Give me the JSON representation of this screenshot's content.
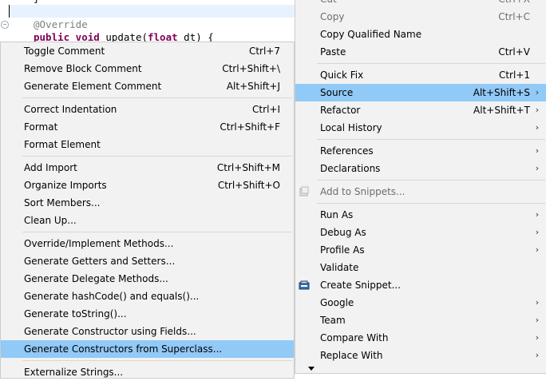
{
  "editor": {
    "line0": "}",
    "annotation": "@Override",
    "method_keywords": "public void ",
    "method_rest": "update(",
    "param_type": "float",
    "param_rest": " dt) {"
  },
  "context_menu": {
    "items": [
      {
        "label": "Cut",
        "accel": "Ctrl+X"
      },
      {
        "label": "Copy",
        "accel": "Ctrl+C"
      },
      {
        "label": "Copy Qualified Name",
        "accel": ""
      },
      {
        "label": "Paste",
        "accel": "Ctrl+V"
      },
      {
        "label": "Quick Fix",
        "accel": "Ctrl+1"
      },
      {
        "label": "Source",
        "accel": "Alt+Shift+S"
      },
      {
        "label": "Refactor",
        "accel": "Alt+Shift+T"
      },
      {
        "label": "Local History",
        "accel": ""
      },
      {
        "label": "References",
        "accel": ""
      },
      {
        "label": "Declarations",
        "accel": ""
      },
      {
        "label": "Add to Snippets...",
        "accel": ""
      },
      {
        "label": "Run As",
        "accel": ""
      },
      {
        "label": "Debug As",
        "accel": ""
      },
      {
        "label": "Profile As",
        "accel": ""
      },
      {
        "label": "Validate",
        "accel": ""
      },
      {
        "label": "Create Snippet...",
        "accel": ""
      },
      {
        "label": "Google",
        "accel": ""
      },
      {
        "label": "Team",
        "accel": ""
      },
      {
        "label": "Compare With",
        "accel": ""
      },
      {
        "label": "Replace With",
        "accel": ""
      }
    ],
    "submenu_arrow": "›",
    "more_arrow": "▼"
  },
  "source_menu": {
    "items": [
      {
        "label": "Toggle Comment",
        "accel": "Ctrl+7"
      },
      {
        "label": "Remove Block Comment",
        "accel": "Ctrl+Shift+\\"
      },
      {
        "label": "Generate Element Comment",
        "accel": "Alt+Shift+J"
      },
      {
        "label": "Correct Indentation",
        "accel": "Ctrl+I"
      },
      {
        "label": "Format",
        "accel": "Ctrl+Shift+F"
      },
      {
        "label": "Format Element",
        "accel": ""
      },
      {
        "label": "Add Import",
        "accel": "Ctrl+Shift+M"
      },
      {
        "label": "Organize Imports",
        "accel": "Ctrl+Shift+O"
      },
      {
        "label": "Sort Members...",
        "accel": ""
      },
      {
        "label": "Clean Up...",
        "accel": ""
      },
      {
        "label": "Override/Implement Methods...",
        "accel": ""
      },
      {
        "label": "Generate Getters and Setters...",
        "accel": ""
      },
      {
        "label": "Generate Delegate Methods...",
        "accel": ""
      },
      {
        "label": "Generate hashCode() and equals()...",
        "accel": ""
      },
      {
        "label": "Generate toString()...",
        "accel": ""
      },
      {
        "label": "Generate Constructor using Fields...",
        "accel": ""
      },
      {
        "label": "Generate Constructors from Superclass...",
        "accel": ""
      },
      {
        "label": "Externalize Strings...",
        "accel": ""
      }
    ]
  },
  "colors": {
    "highlight": "#91c9f7",
    "menu_bg": "#f2f2f2",
    "annotation": "#7f7f7f",
    "keyword": "#7f0055"
  }
}
